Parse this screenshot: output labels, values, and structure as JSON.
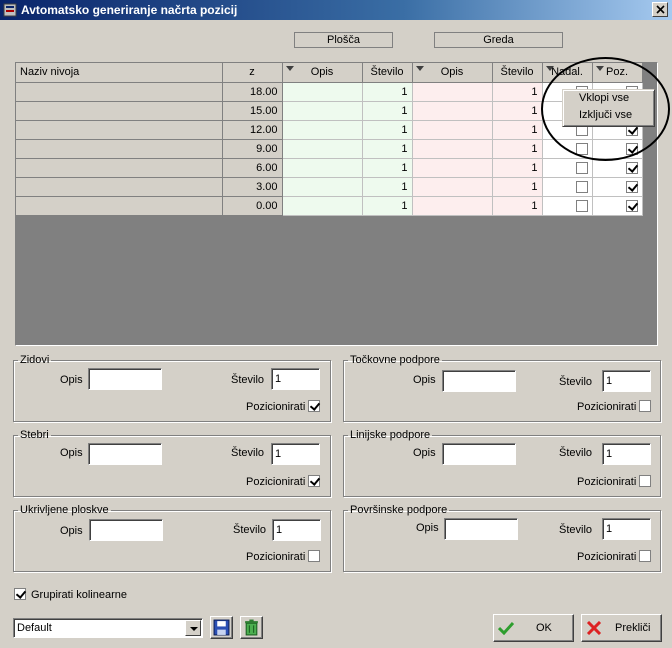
{
  "window": {
    "title": "Avtomatsko generiranje načrta pozicij"
  },
  "groups": {
    "plosca": "Plošča",
    "greda": "Greda"
  },
  "columns": {
    "naziv": "Naziv nivoja",
    "z": "z",
    "opis1": "Opis",
    "stevilo1": "Število",
    "opis2": "Opis",
    "stevilo2": "Število",
    "nadal": "Nadal.",
    "poz": "Poz."
  },
  "rows": [
    {
      "z": "18.00",
      "st1": "1",
      "st2": "1",
      "nadal": false,
      "poz": true
    },
    {
      "z": "15.00",
      "st1": "1",
      "st2": "1",
      "nadal": false,
      "poz": true
    },
    {
      "z": "12.00",
      "st1": "1",
      "st2": "1",
      "nadal": false,
      "poz": true
    },
    {
      "z": "9.00",
      "st1": "1",
      "st2": "1",
      "nadal": false,
      "poz": true
    },
    {
      "z": "6.00",
      "st1": "1",
      "st2": "1",
      "nadal": false,
      "poz": true
    },
    {
      "z": "3.00",
      "st1": "1",
      "st2": "1",
      "nadal": false,
      "poz": true
    },
    {
      "z": "0.00",
      "st1": "1",
      "st2": "1",
      "nadal": false,
      "poz": true
    }
  ],
  "context_menu": {
    "enable_all": "Vklopi vse",
    "disable_all": "Izključi vse"
  },
  "labels": {
    "opis": "Opis",
    "stevilo": "Število",
    "pozicionirati": "Pozicionirati"
  },
  "sections": {
    "zidovi": {
      "title": "Zidovi",
      "stevilo": "1",
      "poz": true
    },
    "tockovne": {
      "title": "Točkovne podpore",
      "stevilo": "1",
      "poz": false
    },
    "stebri": {
      "title": "Stebri",
      "stevilo": "1",
      "poz": true
    },
    "linijske": {
      "title": "Linijske podpore",
      "stevilo": "1",
      "poz": false
    },
    "ukrivljene": {
      "title": "Ukrivljene ploskve",
      "stevilo": "1",
      "poz": false
    },
    "povrsinske": {
      "title": "Površinske podpore",
      "stevilo": "1",
      "poz": false
    }
  },
  "grupirati": {
    "label": "Grupirati kolinearne",
    "checked": true
  },
  "footer": {
    "preset": "Default",
    "ok": "OK",
    "cancel": "Prekliči"
  },
  "icons": {
    "save": "save-icon",
    "delete": "trash-icon",
    "ok": "check-icon",
    "cancel": "x-icon"
  }
}
